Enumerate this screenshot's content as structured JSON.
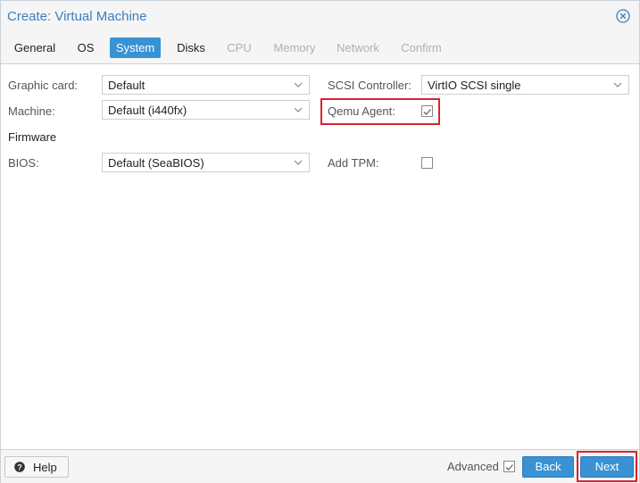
{
  "dialog": {
    "title": "Create: Virtual Machine",
    "close_icon": "close-circle-icon"
  },
  "tabs": [
    {
      "label": "General",
      "state": "enabled"
    },
    {
      "label": "OS",
      "state": "enabled"
    },
    {
      "label": "System",
      "state": "active"
    },
    {
      "label": "Disks",
      "state": "enabled"
    },
    {
      "label": "CPU",
      "state": "disabled"
    },
    {
      "label": "Memory",
      "state": "disabled"
    },
    {
      "label": "Network",
      "state": "disabled"
    },
    {
      "label": "Confirm",
      "state": "disabled"
    }
  ],
  "form": {
    "graphic_card": {
      "label": "Graphic card:",
      "value": "Default"
    },
    "machine": {
      "label": "Machine:",
      "value": "Default (i440fx)"
    },
    "firmware_section": "Firmware",
    "bios": {
      "label": "BIOS:",
      "value": "Default (SeaBIOS)"
    },
    "scsi_controller": {
      "label": "SCSI Controller:",
      "value": "VirtIO SCSI single"
    },
    "qemu_agent": {
      "label": "Qemu Agent:",
      "checked": true
    },
    "add_tpm": {
      "label": "Add TPM:",
      "checked": false
    }
  },
  "footer": {
    "help_label": "Help",
    "advanced_label": "Advanced",
    "advanced_checked": true,
    "back_label": "Back",
    "next_label": "Next"
  },
  "colors": {
    "accent": "#3892d4",
    "highlight": "#d9232c",
    "title": "#3b7fc0"
  }
}
